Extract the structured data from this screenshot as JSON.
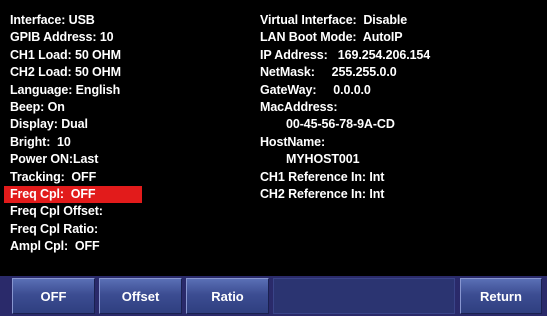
{
  "left_column": [
    "Interface: USB",
    "GPIB Address: 10",
    "CH1 Load: 50 OHM",
    "CH2 Load: 50 OHM",
    "Language: English",
    "Beep: On",
    "Display: Dual",
    "Bright:  10",
    "Power ON:Last",
    "Tracking:  OFF",
    "Freq Cpl:  OFF",
    "Freq Cpl Offset:",
    "Freq Cpl Ratio:",
    "Ampl Cpl:  OFF"
  ],
  "right_column": [
    "Virtual Interface:  Disable",
    "LAN Boot Mode:  AutoIP",
    "IP Address:   169.254.206.154",
    "NetMask:     255.255.0.0",
    "GateWay:     0.0.0.0",
    "MacAddress:",
    "00-45-56-78-9A-CD",
    "HostName:",
    "MYHOST001",
    "CH1 Reference In: Int",
    "CH2 Reference In: Int"
  ],
  "softkeys": {
    "key1": "OFF",
    "key2": "Offset",
    "key3": "Ratio",
    "key4": "",
    "key5": "Return"
  },
  "colors": {
    "background": "#000000",
    "text": "#ffffff",
    "highlight": "#e21b1b",
    "softkey": "#3c4d92"
  }
}
